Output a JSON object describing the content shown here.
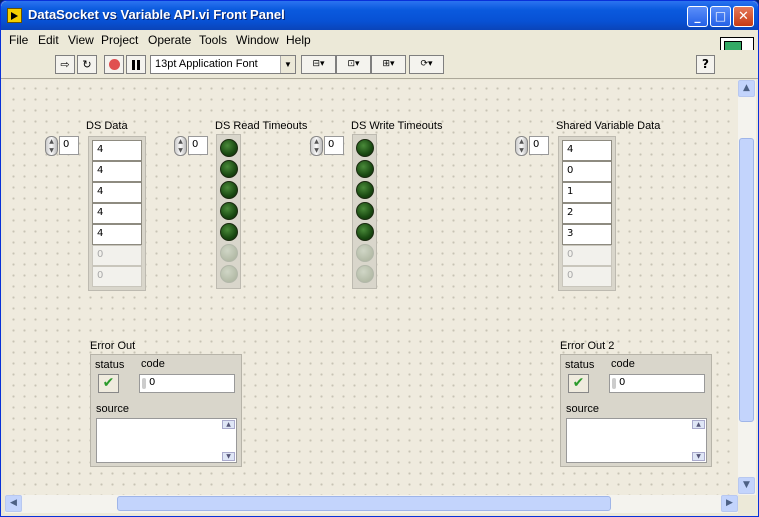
{
  "window": {
    "title": "DataSocket vs Variable API.vi Front Panel",
    "min": "_",
    "max": "□",
    "close": "✕"
  },
  "menu": [
    "File",
    "Edit",
    "View",
    "Project",
    "Operate",
    "Tools",
    "Window",
    "Help"
  ],
  "toolbar": {
    "font": "13pt Application Font",
    "help": "?",
    "vi_icon_number": "1"
  },
  "controls": {
    "ds_data": {
      "label": "DS Data",
      "index": "0",
      "values": [
        "4",
        "4",
        "4",
        "4",
        "4",
        "0",
        "0"
      ]
    },
    "ds_read_timeouts": {
      "label": "DS Read Timeouts",
      "index": "0",
      "lamps": [
        true,
        true,
        true,
        true,
        true,
        false,
        false
      ]
    },
    "ds_write_timeouts": {
      "label": "DS Write Timeouts",
      "index": "0",
      "lamps": [
        true,
        true,
        true,
        true,
        true,
        false,
        false
      ]
    },
    "shared_variable_data": {
      "label": "Shared Variable Data",
      "index": "0",
      "values": [
        "4",
        "0",
        "1",
        "2",
        "3",
        "0",
        "0"
      ]
    }
  },
  "error_out": {
    "label": "Error Out",
    "status_label": "status",
    "code_label": "code",
    "code": "0",
    "source_label": "source"
  },
  "error_out_2": {
    "label": "Error Out 2",
    "status_label": "status",
    "code_label": "code",
    "code": "0",
    "source_label": "source"
  }
}
